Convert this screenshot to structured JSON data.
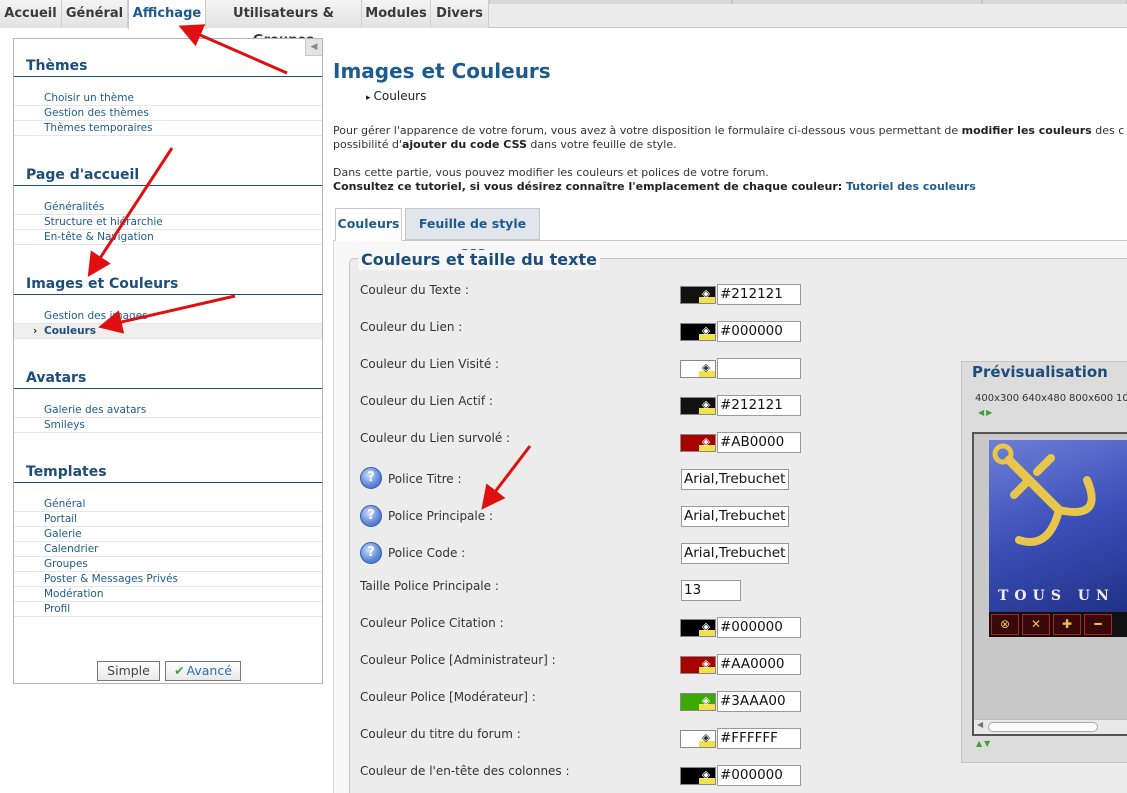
{
  "top_tabs": [
    {
      "label": "Accueil"
    },
    {
      "label": "Général"
    },
    {
      "label": "Affichage"
    },
    {
      "label": "Utilisateurs & Groupes"
    },
    {
      "label": "Modules"
    },
    {
      "label": "Divers"
    }
  ],
  "sidebar": {
    "sections": [
      {
        "title": "Thèmes",
        "items": [
          "Choisir un thème",
          "Gestion des thèmes",
          "Thèmes temporaires"
        ]
      },
      {
        "title": "Page d'accueil",
        "items": [
          "Généralités",
          "Structure et hiérarchie",
          "En-tête & Navigation"
        ]
      },
      {
        "title": "Images et Couleurs",
        "items": [
          "Gestion des images",
          "Couleurs"
        ]
      },
      {
        "title": "Avatars",
        "items": [
          "Galerie des avatars",
          "Smileys"
        ]
      },
      {
        "title": "Templates",
        "items": [
          "Général",
          "Portail",
          "Galerie",
          "Calendrier",
          "Groupes",
          "Poster & Messages Privés",
          "Modération",
          "Profil"
        ]
      }
    ],
    "selected_item": "Couleurs",
    "mode_simple": "Simple",
    "mode_advanced": "Avancé"
  },
  "main": {
    "title": "Images et Couleurs",
    "breadcrumb": "Couleurs",
    "intro1_a": "Pour gérer l'apparence de votre forum, vous avez à votre disposition le formulaire ci-dessous vous permettant de ",
    "intro1_b": "modifier les couleurs",
    "intro1_c": " des c",
    "intro2_a": "possibilité d'",
    "intro2_b": "ajouter du code CSS",
    "intro2_c": " dans votre feuille de style.",
    "intro3": "Dans cette partie, vous pouvez modifier les couleurs et polices de votre forum.",
    "intro4_a": "Consultez ce tutoriel, si vous désirez connaître l'emplacement de chaque couleur: ",
    "intro4_link": "Tutoriel des couleurs",
    "tabs": [
      "Couleurs",
      "Feuille de style CSS"
    ],
    "fieldset_title": "Couleurs et taille du texte",
    "rows": [
      {
        "label": "Couleur du Texte  :",
        "type": "color",
        "value": "#212121",
        "swatch": "#111111"
      },
      {
        "label": "Couleur du Lien  :",
        "type": "color",
        "value": "#000000",
        "swatch": "#000000"
      },
      {
        "label": "Couleur du Lien Visité  :",
        "type": "color",
        "value": "",
        "swatch": "#ffffff"
      },
      {
        "label": "Couleur du Lien Actif  :",
        "type": "color",
        "value": "#212121",
        "swatch": "#111111"
      },
      {
        "label": "Couleur du Lien survolé  :",
        "type": "color",
        "value": "#AB0000",
        "swatch": "#ab0000"
      },
      {
        "label": "Police Titre  :",
        "type": "font",
        "value": "Arial,Trebuchet MS"
      },
      {
        "label": "Police Principale  :",
        "type": "font",
        "value": "Arial,Trebuchet MS"
      },
      {
        "label": "Police Code  :",
        "type": "font",
        "value": "Arial,Trebuchet MS"
      },
      {
        "label": "Taille Police Principale  :",
        "type": "size",
        "value": "13"
      },
      {
        "label": "Couleur Police Citation  :",
        "type": "color",
        "value": "#000000",
        "swatch": "#000000"
      },
      {
        "label": "Couleur Police [Administrateur]  :",
        "type": "color",
        "value": "#AA0000",
        "swatch": "#aa0000"
      },
      {
        "label": "Couleur Police [Modérateur]  :",
        "type": "color",
        "value": "#3AAA00",
        "swatch": "#3aaa00"
      },
      {
        "label": "Couleur du titre du forum  :",
        "type": "color",
        "value": "#FFFFFF",
        "swatch": "#ffffff"
      },
      {
        "label": "Couleur de l'en-tête des colonnes  :",
        "type": "color",
        "value": "#000000",
        "swatch": "#000000"
      }
    ]
  },
  "preview": {
    "title": "Prévisualisation",
    "resolutions": [
      "400x300",
      "640x480",
      "800x600",
      "10"
    ],
    "banner_text": "TOUS UN"
  },
  "colors": {
    "accent": "#1d5b8f",
    "heading": "#1d4d7a",
    "annotation_arrow": "#e01010"
  }
}
